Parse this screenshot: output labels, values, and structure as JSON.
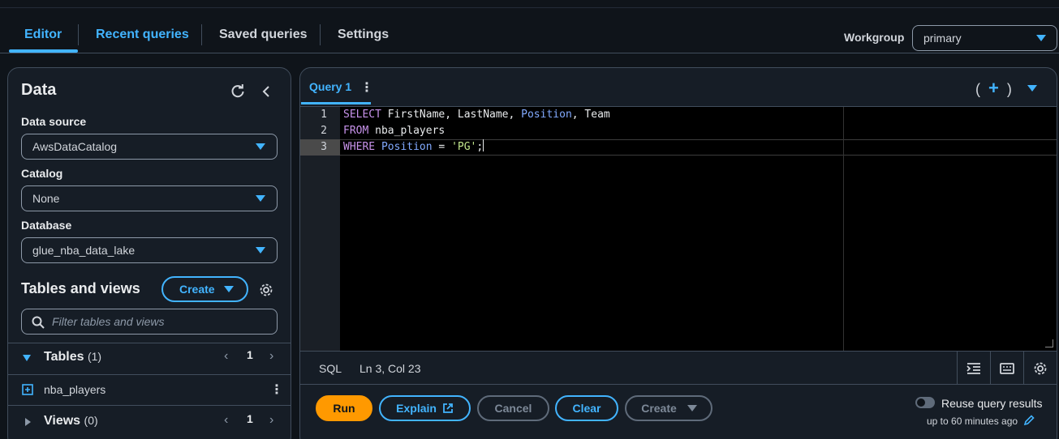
{
  "tabs": [
    {
      "label": "Editor",
      "active": true
    },
    {
      "label": "Recent queries"
    },
    {
      "label": "Saved queries"
    },
    {
      "label": "Settings"
    }
  ],
  "workgroup": {
    "label": "Workgroup",
    "value": "primary"
  },
  "data_panel": {
    "title": "Data",
    "data_source": {
      "label": "Data source",
      "value": "AwsDataCatalog"
    },
    "catalog": {
      "label": "Catalog",
      "value": "None"
    },
    "database": {
      "label": "Database",
      "value": "glue_nba_data_lake"
    },
    "tables_and_views": {
      "title": "Tables and views",
      "create_label": "Create",
      "filter_placeholder": "Filter tables and views"
    },
    "tables": {
      "label": "Tables",
      "count": "(1)",
      "page": "1",
      "items": [
        "nba_players"
      ]
    },
    "views": {
      "label": "Views",
      "count": "(0)",
      "page": "1"
    }
  },
  "query_tab": {
    "label": "Query 1"
  },
  "editor": {
    "line_numbers": [
      "1",
      "2",
      "3"
    ],
    "lines": [
      {
        "kw": "SELECT",
        "rest_a": " FirstName, LastName, ",
        "fn": "Position",
        "rest_b": ", Team"
      },
      {
        "kw": "FROM",
        "rest_a": " nba_players"
      },
      {
        "kw": "WHERE",
        "fn": " Position",
        "rest_a": " = ",
        "str": "'PG'",
        "rest_b": ";"
      }
    ],
    "colors": {
      "keyword": "#c792ea",
      "function": "#82aaff",
      "string": "#c3e88d"
    }
  },
  "status": {
    "language": "SQL",
    "position": "Ln 3, Col 23"
  },
  "actions": {
    "run": "Run",
    "explain": "Explain",
    "cancel": "Cancel",
    "clear": "Clear",
    "create": "Create"
  },
  "reuse": {
    "label": "Reuse query results",
    "sub": "up to 60 minutes ago"
  },
  "accent": "#42b4ff",
  "primary_button_color": "#ff9900"
}
